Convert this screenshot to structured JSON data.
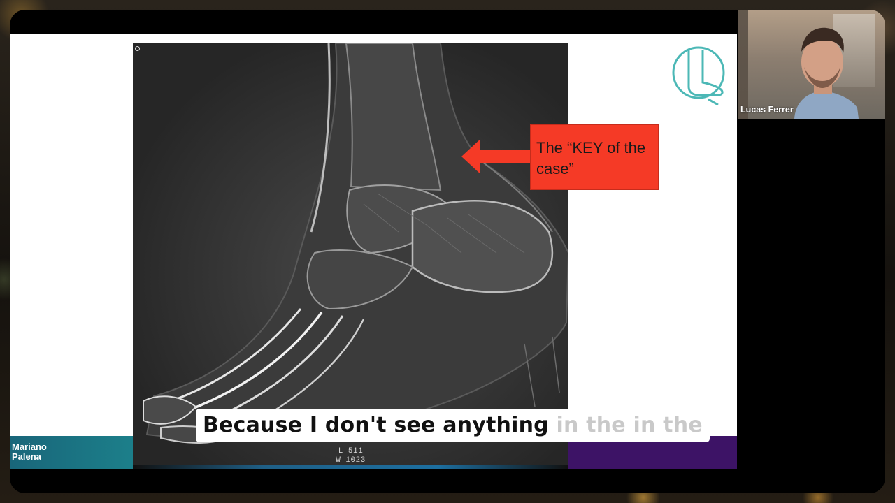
{
  "slide": {
    "callout_text": "The “KEY of the case”",
    "xray": {
      "level_label": "L 511",
      "width_label": "W 1023"
    },
    "logo_icon": "foot-logo-icon"
  },
  "presenter": {
    "name_line1": "Mariano",
    "name_line2": "Palena"
  },
  "participant": {
    "name": "Lucas Ferrer"
  },
  "caption": {
    "spoken": "Because I don't see anything",
    "pending": " in the in the"
  },
  "colors": {
    "callout_red": "#f53a26",
    "logo_teal": "#4cb8b6",
    "footer_teal": "#19667a",
    "footer_purple": "#3d1366"
  }
}
